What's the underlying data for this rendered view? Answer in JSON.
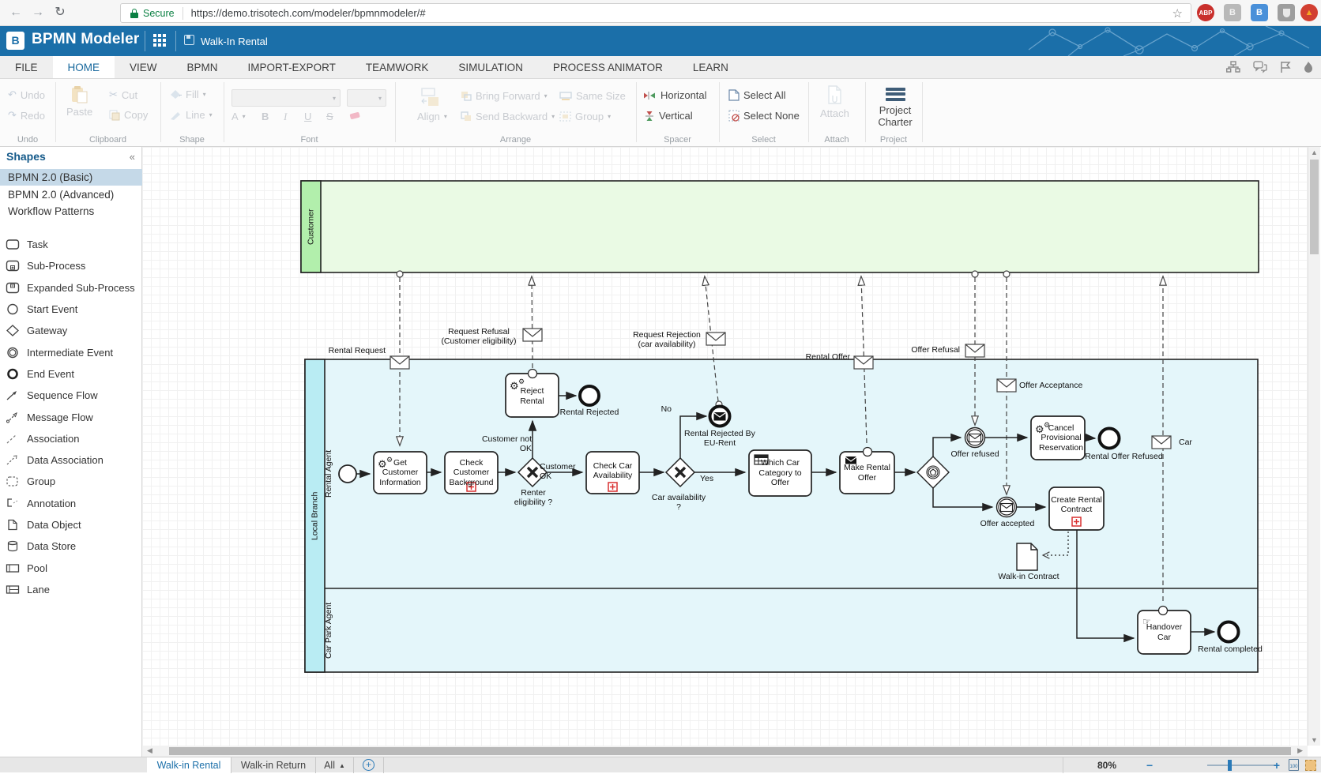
{
  "browser": {
    "secure_label": "Secure",
    "url": "https://demo.trisotech.com/modeler/bpmnmodeler/#",
    "extensions": {
      "abp": "ABP",
      "b_gray": "B",
      "b_blue": "B"
    }
  },
  "header": {
    "app_title": "BPMN Modeler",
    "document_title": "Walk-In Rental"
  },
  "menu": {
    "items": [
      "FILE",
      "HOME",
      "VIEW",
      "BPMN",
      "IMPORT-EXPORT",
      "TEAMWORK",
      "SIMULATION",
      "PROCESS ANIMATOR",
      "LEARN"
    ]
  },
  "ribbon": {
    "undo": {
      "undo": "Undo",
      "redo": "Redo",
      "label": "Undo"
    },
    "clipboard": {
      "paste": "Paste",
      "cut": "Cut",
      "copy": "Copy",
      "label": "Clipboard"
    },
    "shape": {
      "fill": "Fill",
      "line": "Line",
      "label": "Shape"
    },
    "font": {
      "bold": "B",
      "italic": "I",
      "underline": "U",
      "strike": "S",
      "color": "A",
      "label": "Font"
    },
    "arrange": {
      "align": "Align",
      "bring_forward": "Bring Forward",
      "send_backward": "Send Backward",
      "same_size": "Same Size",
      "group": "Group",
      "label": "Arrange"
    },
    "spacer": {
      "horizontal": "Horizontal",
      "vertical": "Vertical",
      "label": "Spacer"
    },
    "select": {
      "select_all": "Select All",
      "select_none": "Select None",
      "label": "Select"
    },
    "attach": {
      "attach": "Attach",
      "label": "Attach"
    },
    "project": {
      "charter": "Project Charter",
      "label": "Project"
    }
  },
  "sidebar": {
    "title": "Shapes",
    "collapse": "«",
    "categories": [
      "BPMN 2.0 (Basic)",
      "BPMN 2.0 (Advanced)",
      "Workflow Patterns"
    ],
    "items": [
      "Task",
      "Sub-Process",
      "Expanded Sub-Process",
      "Start Event",
      "Gateway",
      "Intermediate Event",
      "End Event",
      "Sequence Flow",
      "Message Flow",
      "Association",
      "Data Association",
      "Group",
      "Annotation",
      "Data Object",
      "Data Store",
      "Pool",
      "Lane"
    ]
  },
  "diagram": {
    "pools": {
      "customer": "Customer",
      "local_branch": "Local Branch"
    },
    "lanes": {
      "rental_agent": "Rental Agent",
      "car_park_agent": "Car Park Agent"
    },
    "tasks": {
      "get_customer_information": "Get Customer Information",
      "check_customer_background": "Check Customer Background",
      "reject_rental": "Reject Rental",
      "check_car_availability": "Check Car Availability",
      "which_car_category_to_offer": "Which Car Category to Offer",
      "make_rental_offer": "Make Rental Offer",
      "cancel_provisional_reservation": "Cancel Provisional Reservation",
      "create_rental_contract": "Create Rental Contract",
      "handover_car": "Handover Car"
    },
    "events": {
      "rental_rejected": "Rental Rejected",
      "rental_rejected_by_eu_rent": "Rental Rejected By EU-Rent",
      "offer_refused": "Offer refused",
      "offer_accepted": "Offer accepted",
      "rental_offer_refused": "Rental Offer Refused",
      "rental_completed": "Rental completed"
    },
    "gateways": {
      "renter_eligibility": "Renter eligibility ?",
      "car_availability": "Car availability ?"
    },
    "flows": {
      "customer_not_ok": "Customer not OK",
      "customer_ok": "Customer OK",
      "no": "No",
      "yes": "Yes"
    },
    "messages": {
      "rental_request": "Rental Request",
      "request_refusal": "Request Refusal (Customer eligibility)",
      "request_rejection": "Request Rejection (car availability)",
      "rental_offer": "Rental Offer",
      "offer_refusal": "Offer Refusal",
      "offer_acceptance": "Offer Acceptance",
      "car": "Car"
    },
    "data_objects": {
      "walk_in_contract": "Walk-in Contract"
    }
  },
  "bottom": {
    "tabs": [
      "Walk-in Rental",
      "Walk-in Return"
    ],
    "all": "All",
    "zoom": "80%"
  }
}
